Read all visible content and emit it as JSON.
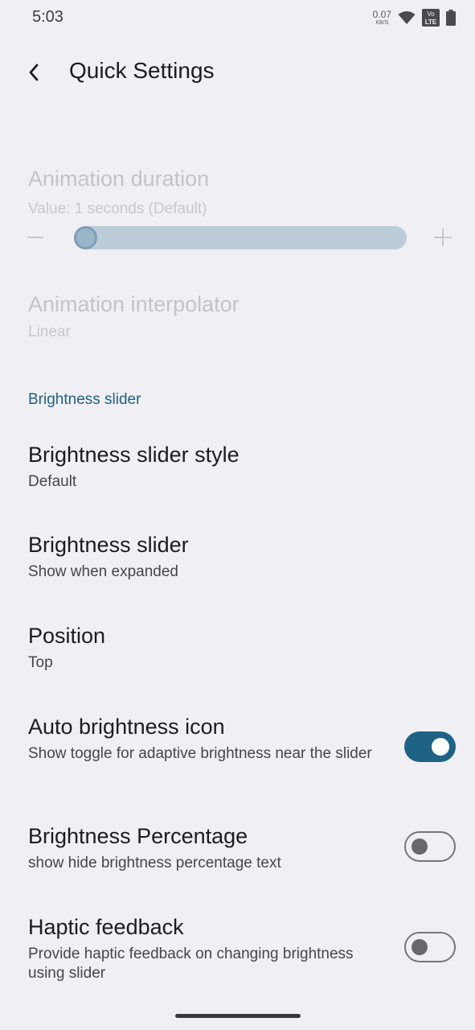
{
  "status_bar": {
    "time": "5:03",
    "net_speed": "0.07",
    "net_speed_unit": "KB/S",
    "volte_top": "Vo",
    "volte_bottom": "LTE",
    "icons": [
      "wifi-icon",
      "volte-icon",
      "battery-icon"
    ]
  },
  "app_bar": {
    "title": "Quick Settings",
    "back_icon": "chevron-left-icon"
  },
  "animation": {
    "duration_title": "Animation duration",
    "duration_value": "Value: 1 seconds (Default)",
    "duration_slider_fraction": 0,
    "interpolator_title": "Animation interpolator",
    "interpolator_value": "Linear"
  },
  "brightness": {
    "section_header": "Brightness slider",
    "items": [
      {
        "title": "Brightness slider style",
        "subtitle": "Default"
      },
      {
        "title": "Brightness slider",
        "subtitle": "Show when expanded"
      },
      {
        "title": "Position",
        "subtitle": "Top"
      },
      {
        "title": "Auto brightness icon",
        "subtitle": "Show toggle for adaptive brightness near the slider",
        "toggle": true
      },
      {
        "title": "Brightness Percentage",
        "subtitle": "show hide brightness percentage text",
        "toggle": false
      },
      {
        "title": "Haptic feedback",
        "subtitle": "Provide haptic feedback on changing brightness using slider",
        "toggle": false
      }
    ]
  },
  "colors": {
    "accent": "#1e6385",
    "background": "#f0eff3",
    "section_header": "#1f6183"
  }
}
